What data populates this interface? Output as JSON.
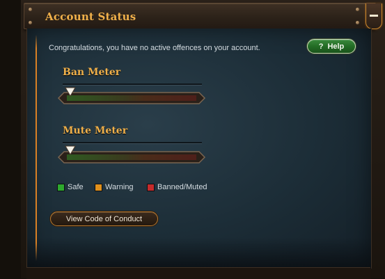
{
  "header": {
    "title": "Account Status",
    "collapse_icon": "minus-icon"
  },
  "status_message": "Congratulations, you have no active offences on your account.",
  "help_button": {
    "icon": "question-mark-icon",
    "icon_glyph": "?",
    "label": "Help"
  },
  "meters": [
    {
      "title": "Ban Meter",
      "level": 0
    },
    {
      "title": "Mute Meter",
      "level": 0
    }
  ],
  "legend": [
    {
      "label": "Safe",
      "color": "#2ea92e"
    },
    {
      "label": "Warning",
      "color": "#e0901c"
    },
    {
      "label": "Banned/Muted",
      "color": "#c62b2b"
    }
  ],
  "conduct_button": {
    "label": "View Code of Conduct"
  },
  "colors": {
    "accent": "#f0b04a",
    "panel": "#1c2d37",
    "help_green": "#2a7a2c"
  }
}
